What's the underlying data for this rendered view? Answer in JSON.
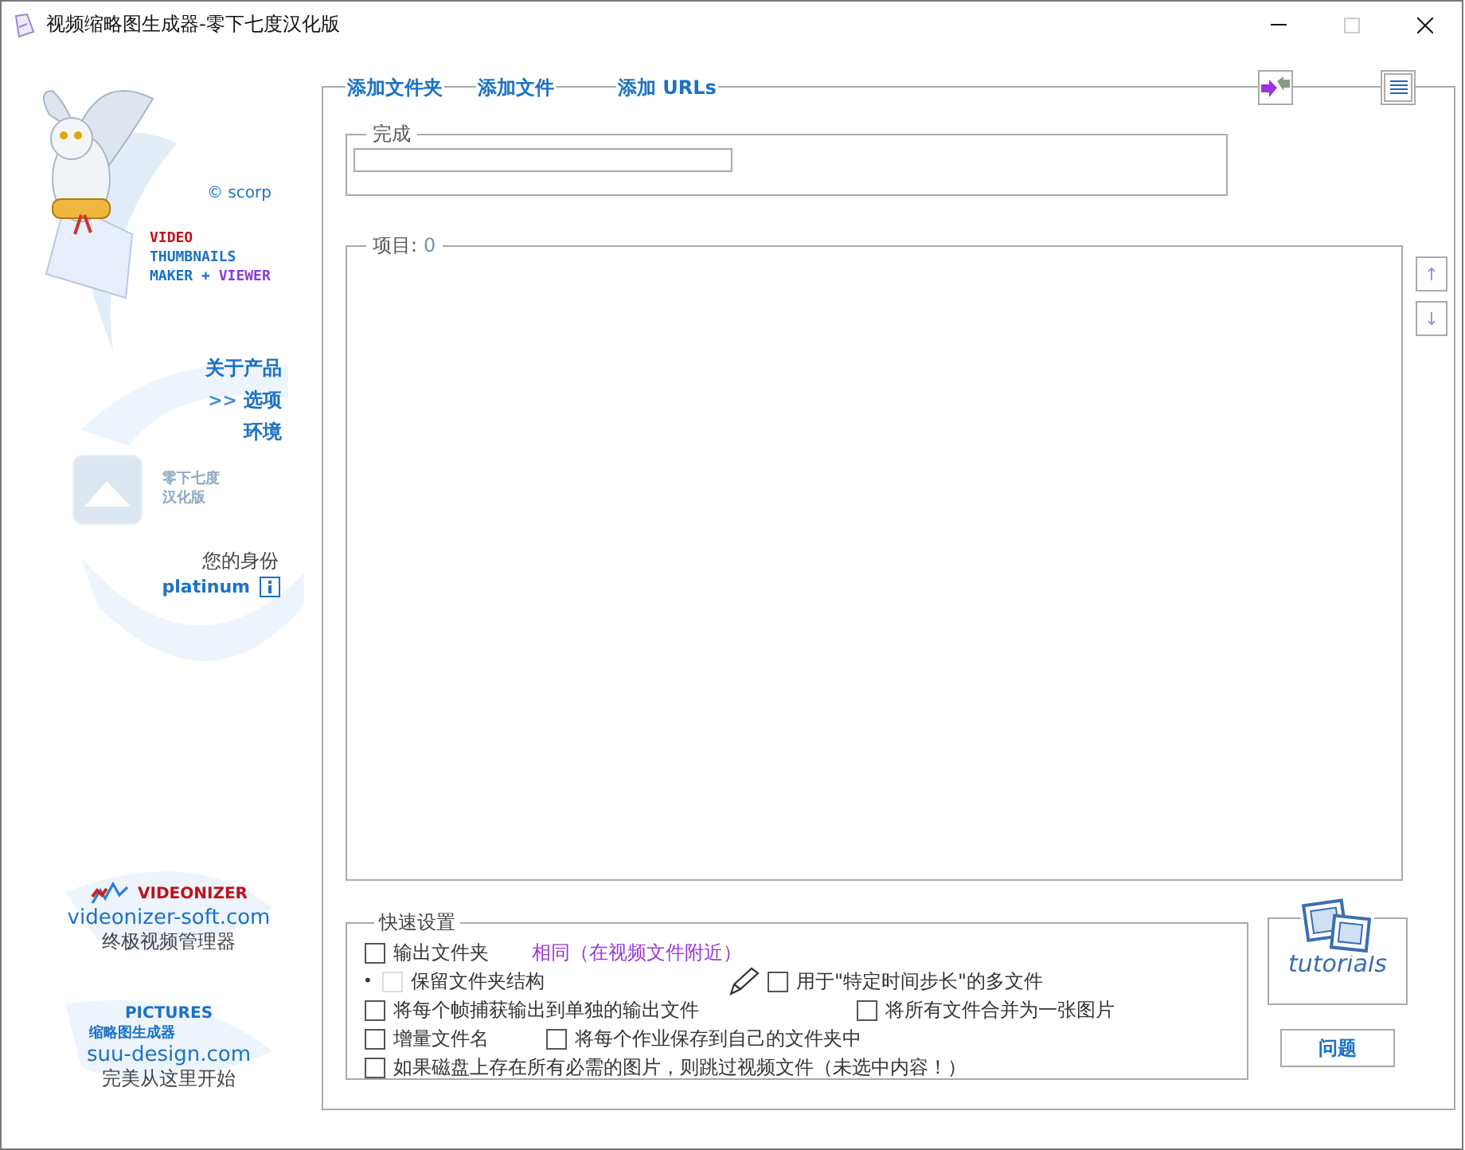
{
  "window": {
    "title": "视频缩略图生成器-零下七度汉化版"
  },
  "sidebar": {
    "copyright": "© scorp",
    "product_lines": [
      [
        "VIDEO"
      ],
      [
        "THUMBNAILS"
      ],
      [
        "MAKER",
        "+",
        "VIEWER"
      ]
    ],
    "nav": {
      "marker": ">>",
      "items": [
        {
          "label": "关于产品",
          "selected": false
        },
        {
          "label": "选项",
          "selected": true
        },
        {
          "label": "环境",
          "selected": false
        }
      ]
    },
    "badge_lines": [
      "零下七度",
      "汉化版"
    ],
    "identity": {
      "label": "您的身份",
      "tier": "platinum"
    },
    "promos": [
      {
        "kind": "chart",
        "brand": "VIDEONIZER",
        "url": "videonizer-soft.com",
        "tagline": "终极视频管理器"
      },
      {
        "kind": "text",
        "brand": "PICTURES",
        "subtitle": "缩略图生成器",
        "url": "suu-design.com",
        "tagline": "完美从这里开始"
      }
    ]
  },
  "main": {
    "links": [
      "添加文件夹",
      "添加文件",
      "添加 URLs"
    ],
    "progress": {
      "title": "完成",
      "level": 0
    },
    "items": {
      "label": "项目:",
      "count": "0"
    },
    "move_buttons": [
      "↑",
      "↓"
    ]
  },
  "quick_settings": {
    "title": "快速设置",
    "rows": [
      {
        "options": [
          {
            "kind": "checkbox",
            "label": "输出文件夹",
            "checked": false,
            "disabled": false,
            "value": "相同（在视频文件附近）"
          }
        ]
      },
      {
        "bullet": "•",
        "options": [
          {
            "kind": "checkbox",
            "label": "保留文件夹结构",
            "checked": false,
            "disabled": true
          },
          {
            "kind": "tool",
            "label": "用于\"特定时间步长\"的多文件",
            "checked": false,
            "disabled": false
          }
        ]
      },
      {
        "options": [
          {
            "kind": "checkbox",
            "label": "将每个帧捕获输出到单独的输出文件",
            "checked": false,
            "disabled": false
          },
          {
            "kind": "checkbox",
            "label": "将所有文件合并为一张图片",
            "checked": false,
            "disabled": false
          }
        ]
      },
      {
        "options": [
          {
            "kind": "checkbox",
            "label": "增量文件名",
            "checked": false,
            "disabled": false
          },
          {
            "kind": "checkbox",
            "label": "将每个作业保存到自己的文件夹中",
            "checked": false,
            "disabled": false
          }
        ]
      },
      {
        "options": [
          {
            "kind": "checkbox",
            "label": "如果磁盘上存在所有必需的图片，则跳过视频文件（未选中内容！）",
            "checked": false,
            "disabled": false
          }
        ]
      }
    ]
  },
  "tutorials": {
    "label": "tutorials"
  },
  "help_button": "问题"
}
